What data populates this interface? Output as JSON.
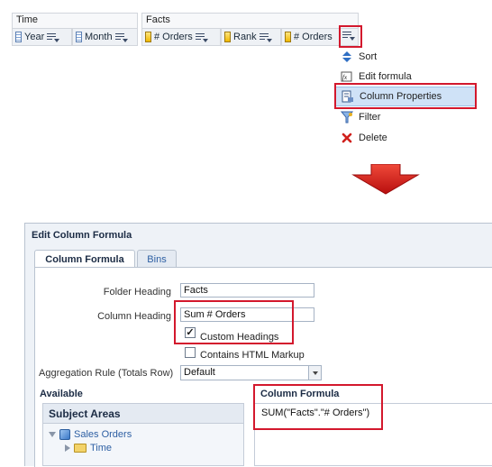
{
  "criteria": {
    "groups": [
      {
        "label": "Time"
      },
      {
        "label": "Facts"
      }
    ],
    "columns": [
      {
        "label": "Year"
      },
      {
        "label": "Month"
      },
      {
        "label": "# Orders"
      },
      {
        "label": "Rank"
      },
      {
        "label": "# Orders"
      }
    ]
  },
  "menu": {
    "items": [
      {
        "label": "Sort",
        "icon": "sort-icon"
      },
      {
        "label": "Edit formula",
        "icon": "edit-formula-icon"
      },
      {
        "label": "Column Properties",
        "icon": "column-properties-icon"
      },
      {
        "label": "Filter",
        "icon": "filter-icon"
      },
      {
        "label": "Delete",
        "icon": "delete-icon"
      }
    ],
    "selected_item": "Column Properties"
  },
  "dialog": {
    "title": "Edit Column Formula",
    "tabs": [
      {
        "label": "Column Formula"
      },
      {
        "label": "Bins"
      }
    ],
    "active_tab": "Column Formula",
    "folder_heading_label": "Folder Heading",
    "folder_heading_value": "Facts",
    "column_heading_label": "Column Heading",
    "column_heading_value": "Sum # Orders",
    "custom_headings_label": "Custom Headings",
    "custom_headings_checked": true,
    "html_markup_label": "Contains HTML Markup",
    "html_markup_checked": false,
    "aggregation_label": "Aggregation Rule (Totals Row)",
    "aggregation_value": "Default",
    "available_label": "Available",
    "subject_areas_title": "Subject Areas",
    "tree": [
      {
        "label": "Sales Orders",
        "icon": "cube-icon",
        "expanded": true
      },
      {
        "label": "Time",
        "icon": "folder-icon",
        "expanded": false
      }
    ],
    "formula_section_label": "Column Formula",
    "formula_value": "SUM(\"Facts\".\"# Orders\")"
  },
  "colors": {
    "highlight_red": "#d3182d",
    "arrow_red": "#e21d1d",
    "selection_blue": "#cfe2f7",
    "link_blue": "#2d5fa3"
  }
}
